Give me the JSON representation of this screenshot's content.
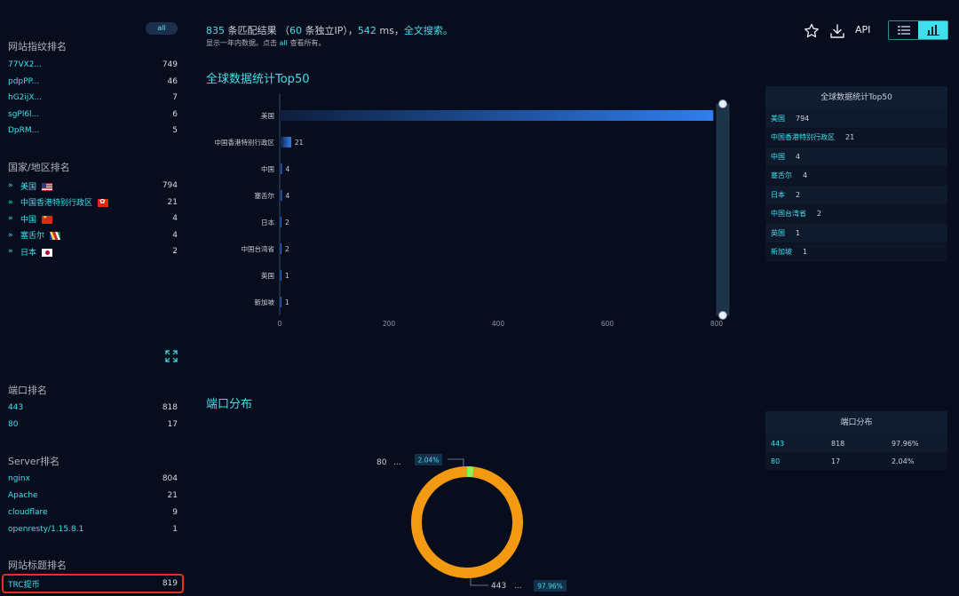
{
  "sidebar": {
    "all_label": "all",
    "fingerprint": {
      "title": "网站指纹排名",
      "items": [
        {
          "label": "77VX2...",
          "count": "749"
        },
        {
          "label": "pdpPP...",
          "count": "46"
        },
        {
          "label": "hG2ijX...",
          "count": "7"
        },
        {
          "label": "sgPl6l...",
          "count": "6"
        },
        {
          "label": "DpRM...",
          "count": "5"
        }
      ]
    },
    "country": {
      "title": "国家/地区排名",
      "items": [
        {
          "label": "美国",
          "count": "794",
          "flag": "flag-us"
        },
        {
          "label": "中国香港特别行政区",
          "count": "21",
          "flag": "flag-hk"
        },
        {
          "label": "中国",
          "count": "4",
          "flag": "flag-cn"
        },
        {
          "label": "塞舌尔",
          "count": "4",
          "flag": "flag-sc"
        },
        {
          "label": "日本",
          "count": "2",
          "flag": "flag-jp"
        }
      ]
    },
    "ports": {
      "title": "端口排名",
      "items": [
        {
          "label": "443",
          "count": "818"
        },
        {
          "label": "80",
          "count": "17"
        }
      ]
    },
    "server": {
      "title": "Server排名",
      "items": [
        {
          "label": "nginx",
          "count": "804"
        },
        {
          "label": "Apache",
          "count": "21"
        },
        {
          "label": "cloudflare",
          "count": "9"
        },
        {
          "label": "openresty/1.15.8.1",
          "count": "1"
        }
      ]
    },
    "site_title": {
      "title": "网站标题排名",
      "items": [
        {
          "label": "TRC提币",
          "count": "819"
        }
      ]
    }
  },
  "header": {
    "results_count": "835",
    "results_text": " 条匹配结果 （",
    "unique_ip": "60",
    "unique_ip_text": " 条独立IP），",
    "time": "542",
    "time_text": " ms，",
    "fulltext": "全文搜索。",
    "sub_pre": "显示一年内数据。点击 ",
    "sub_all": "all",
    "sub_post": " 查看所有。",
    "api_label": "API"
  },
  "icons": {
    "star": "star-icon",
    "download": "download-icon",
    "list_view": "list-view-icon",
    "chart_view": "bar-chart-view-icon",
    "expand": "expand-icon"
  },
  "colors": {
    "accent": "#3ee0ec",
    "bar": "#2f7ef0",
    "donut_main": "#f39a12",
    "donut_minor": "#8ef05a",
    "highlight": "#e0331f"
  },
  "global_stats": {
    "title": "全球数据统计Top50",
    "panel_title": "全球数据统计Top50",
    "rows": [
      {
        "name": "美国",
        "value": "794"
      },
      {
        "name": "中国香港特别行政区",
        "value": "21"
      },
      {
        "name": "中国",
        "value": "4"
      },
      {
        "name": "塞舌尔",
        "value": "4"
      },
      {
        "name": "日本",
        "value": "2"
      },
      {
        "name": "中国台湾省",
        "value": "2"
      },
      {
        "name": "英国",
        "value": "1"
      },
      {
        "name": "新加坡",
        "value": "1"
      }
    ]
  },
  "port_dist": {
    "title": "端口分布",
    "panel_title": "端口分布",
    "rows": [
      {
        "port": "443",
        "count": "818",
        "pct": "97.96%"
      },
      {
        "port": "80",
        "count": "17",
        "pct": "2.04%"
      }
    ],
    "label_80": "80",
    "label_443": "443",
    "dots": "...",
    "pct_80": "2.04%",
    "pct_443": "97.96%"
  },
  "chart_data": [
    {
      "type": "bar",
      "orientation": "horizontal",
      "categories": [
        "美国",
        "中国香港特别行政区",
        "中国",
        "塞舌尔",
        "日本",
        "中国台湾省",
        "英国",
        "新加坡"
      ],
      "values": [
        794,
        21,
        4,
        4,
        2,
        2,
        1,
        1
      ],
      "xlim": [
        0,
        800
      ],
      "xticks": [
        0,
        200,
        400,
        600,
        800
      ],
      "grid": false
    },
    {
      "type": "pie",
      "donut": true,
      "categories": [
        "80",
        "443"
      ],
      "values": [
        17,
        818
      ],
      "percent": [
        "2.04%",
        "97.96%"
      ]
    }
  ]
}
